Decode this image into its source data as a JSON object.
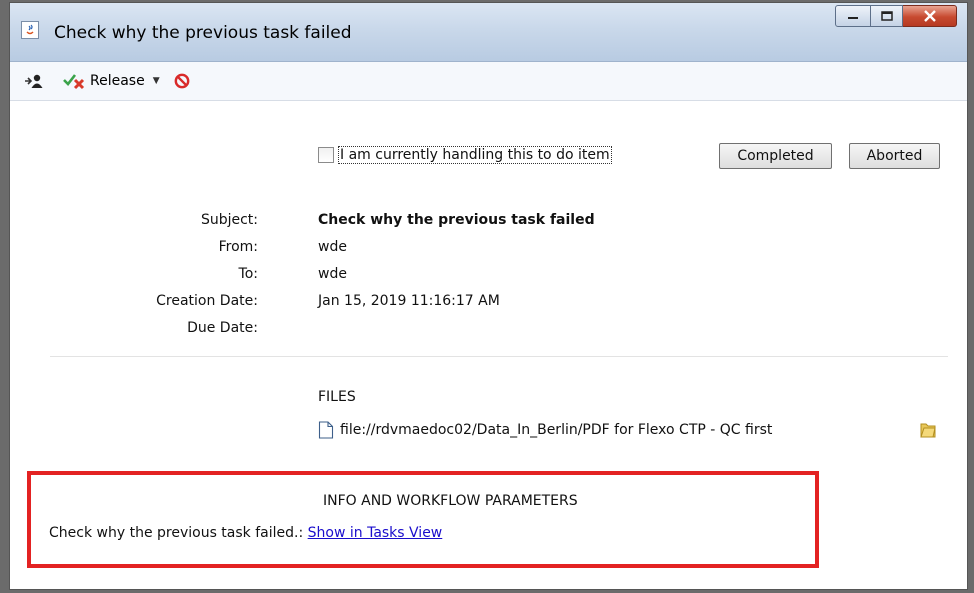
{
  "window": {
    "title": "Check why the previous task failed"
  },
  "toolbar": {
    "release_label": "Release"
  },
  "task": {
    "handling_label": "I am currently handling this to do item",
    "handling_checked": false,
    "completed_label": "Completed",
    "aborted_label": "Aborted"
  },
  "fields": {
    "subject_label": "Subject:",
    "subject_value": "Check why the previous task failed",
    "from_label": "From:",
    "from_value": "wde",
    "to_label": "To:",
    "to_value": "wde",
    "creation_label": "Creation Date:",
    "creation_value": "Jan 15, 2019 11:16:17 AM",
    "due_label": "Due Date:",
    "due_value": ""
  },
  "files": {
    "title": "FILES",
    "items": [
      {
        "path": "file://rdvmaedoc02/Data_In_Berlin/PDF for Flexo CTP - QC first"
      }
    ]
  },
  "params": {
    "title": "INFO AND WORKFLOW PARAMETERS",
    "row_label": "Check why the previous task failed.:",
    "row_link": "Show in Tasks View"
  },
  "colors": {
    "highlight_box": "#e32222",
    "link": "#1a0dcc"
  },
  "icons": [
    "java-app-icon",
    "assign-user-icon",
    "release-icon",
    "cancel-icon",
    "file-icon",
    "folder-icon"
  ]
}
